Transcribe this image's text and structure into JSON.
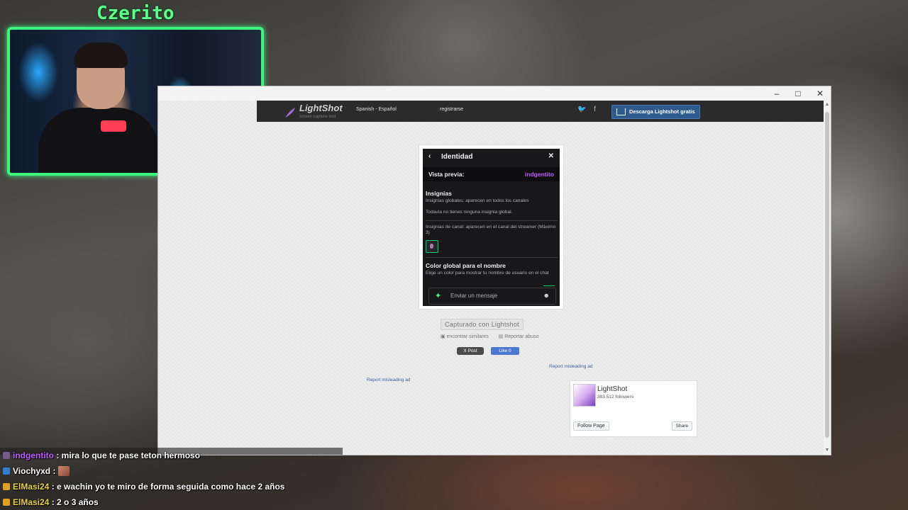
{
  "overlay": {
    "streamer_name": "Czerito",
    "colors": {
      "accent": "#3df57c"
    }
  },
  "window": {
    "minimize_glyph": "–",
    "maximize_glyph": "□",
    "close_glyph": "✕"
  },
  "site": {
    "logo_text": "LightShot",
    "logo_sub": "screen capture tool",
    "language": "Spanish - Español",
    "register": "registrarse",
    "twitter_glyph": "🐦",
    "facebook_glyph": "f",
    "download_label": "Descarga Lightshot gratis"
  },
  "screenshot": {
    "header_title": "Identidad",
    "back_glyph": "‹",
    "close_glyph": "✕",
    "preview_label": "Vista previa:",
    "preview_user": "indgentito",
    "badges_title": "Insignias",
    "global_badges_desc": "Insignias globales: aparecen en todos los canales",
    "no_global_badges": "Todavía no tienes ninguna insignia global.",
    "channel_badges_desc": "Insignias de canal: aparecen en el canal del streamer (Máximo 3)",
    "color_title": "Color global para el nombre",
    "color_desc": "Elige un color para mostrar tu nombre de usuario en el chat",
    "input_placeholder": "Enviar un mensaje",
    "spark_glyph": "✦",
    "emote_glyph": "☻"
  },
  "page": {
    "captured_label": "Capturado con Lightshot",
    "find_similar": "encontrar similares",
    "report_abuse": "Reportar abuso",
    "x_post": "X Post",
    "fb_like": "Like 0",
    "report_ad_1": "Report misleading ad",
    "report_ad_2": "Report misleading ad"
  },
  "fb_widget": {
    "page_name": "LightShot",
    "followers": "383.512 followers",
    "follow_label": "Follow Page",
    "share_label": "Share"
  },
  "chat": [
    {
      "user": "indgentito",
      "message": ": mira lo que te pase teton hermoso",
      "color": "#bf5bff",
      "badge_color": "#7a5a8a",
      "emote": false
    },
    {
      "user": "Viochyxd",
      "message": ":",
      "color": "#ffffff",
      "badge_color": "#2e7fd0",
      "emote": true
    },
    {
      "user": "ElMasi24",
      "message": ": e wachin yo te miro de forma seguida como hace 2 años",
      "color": "#e8d23a",
      "badge_color": "#e0a020",
      "emote": false
    },
    {
      "user": "ElMasi24",
      "message": ": 2 o 3 años",
      "color": "#e8d23a",
      "badge_color": "#e0a020",
      "emote": false
    }
  ]
}
